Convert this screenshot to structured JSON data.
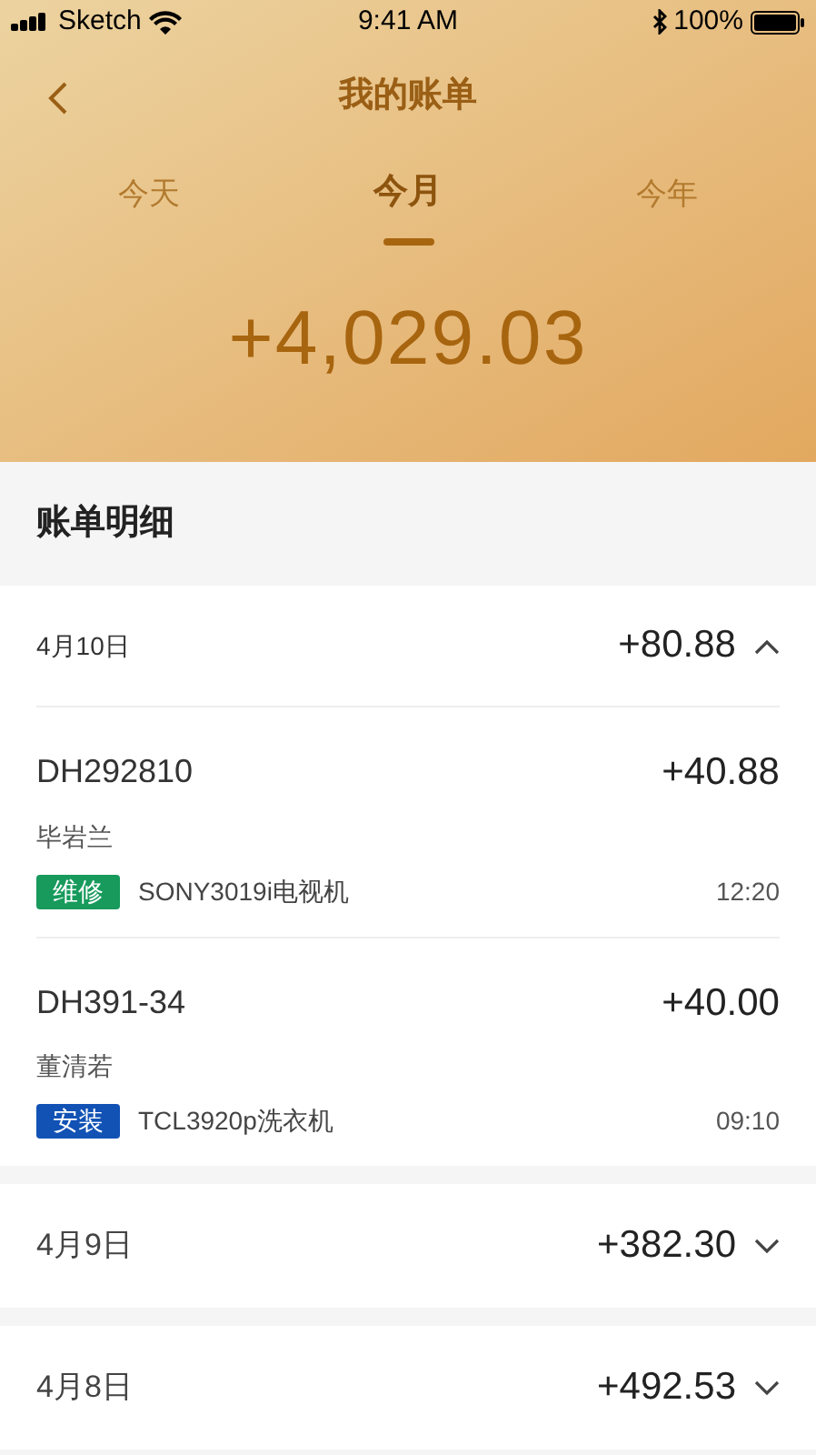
{
  "status_bar": {
    "carrier": "Sketch",
    "time": "9:41 AM",
    "battery": "100%"
  },
  "header": {
    "title": "我的账单",
    "tabs": [
      {
        "label": "今天",
        "selected": false
      },
      {
        "label": "今月",
        "selected": true
      },
      {
        "label": "今年",
        "selected": false
      }
    ],
    "total": "+4,029.03"
  },
  "section_title": "账单明细",
  "groups": [
    {
      "date": "4月10日",
      "amount": "+80.88",
      "expanded": true,
      "items": [
        {
          "order": "DH292810",
          "amount": "+40.88",
          "customer": "毕岩兰",
          "tag": "维修",
          "color": "#179a5c",
          "device": "SONY3019i电视机",
          "time": "12:20"
        },
        {
          "order": "DH391-34",
          "amount": "+40.00",
          "customer": "董清若",
          "tag": "安装",
          "color": "#1252b5",
          "device": "TCL3920p洗衣机",
          "time": "09:10"
        }
      ]
    },
    {
      "date": "4月9日",
      "amount": "+382.30",
      "expanded": false
    },
    {
      "date": "4月8日",
      "amount": "+492.53",
      "expanded": false
    }
  ]
}
